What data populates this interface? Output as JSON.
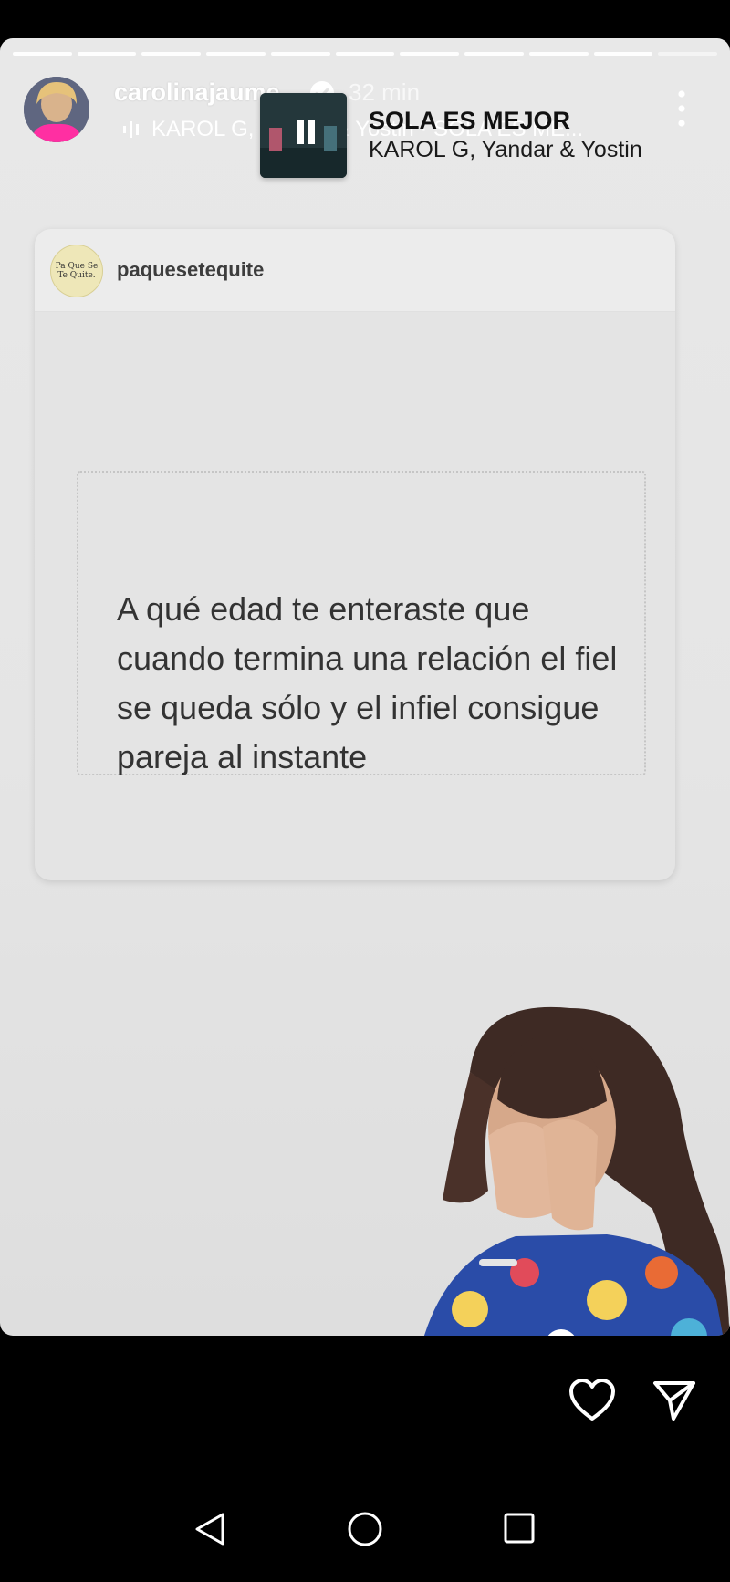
{
  "story": {
    "progress_segments": 11,
    "user": {
      "username": "carolinajaume",
      "verified": true,
      "time_ago": "32 min"
    },
    "music_row": "KAROL G, Yandar & Yostin · SOLA ES ME...",
    "music_sticker": {
      "title": "SOLA ES MEJOR",
      "artist": "KAROL G, Yandar & Yostin"
    },
    "shared_post": {
      "username": "paquesetequite",
      "avatar_text": "Pa Que Se Te Quite.",
      "quote": "A qué edad te enteraste que cuando termina una relación el fiel se queda sólo y el infiel consigue pareja al instante"
    }
  },
  "actions": {
    "like_icon": "heart-icon",
    "send_icon": "send-icon"
  },
  "navbar": {
    "back_icon": "back-triangle-icon",
    "home_icon": "home-circle-icon",
    "recents_icon": "recents-square-icon"
  },
  "colors": {
    "background": "#000000",
    "story_bg": "#e6e6e6",
    "text_dark": "#333333"
  }
}
